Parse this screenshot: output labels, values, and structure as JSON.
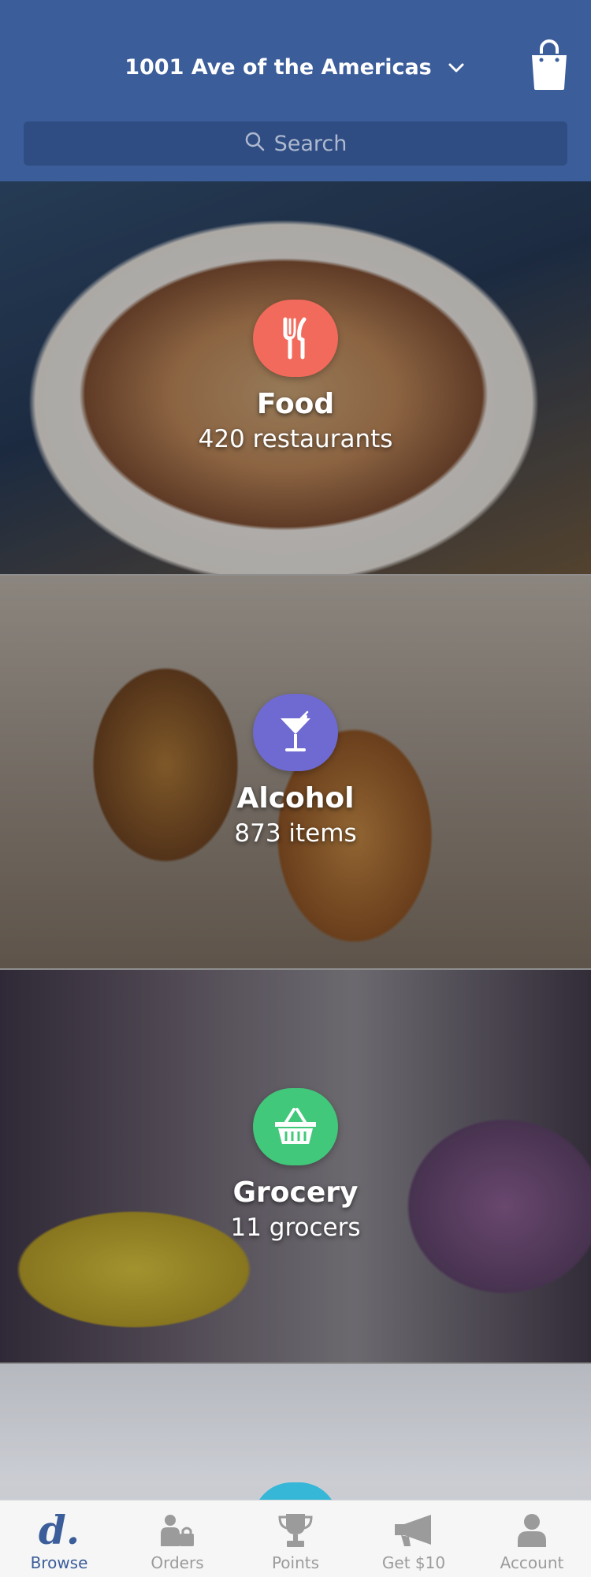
{
  "header": {
    "address": "1001 Ave of the Americas",
    "cart_icon": "shopping-bag-icon",
    "address_dropdown_icon": "chevron-down-icon"
  },
  "search": {
    "placeholder": "Search",
    "icon": "search-icon"
  },
  "categories": [
    {
      "title": "Food",
      "subtitle": "420 restaurants",
      "icon": "fork-knife-icon",
      "color": "#f26a5b"
    },
    {
      "title": "Alcohol",
      "subtitle": "873 items",
      "icon": "cocktail-icon",
      "color": "#6f6ad1"
    },
    {
      "title": "Grocery",
      "subtitle": "11 grocers",
      "icon": "basket-icon",
      "color": "#41c87a"
    },
    {
      "icon": "category-icon",
      "color": "#36b7d8"
    }
  ],
  "tabs": [
    {
      "label": "Browse",
      "icon": "browse-logo-icon",
      "active": true
    },
    {
      "label": "Orders",
      "icon": "orders-icon",
      "active": false
    },
    {
      "label": "Points",
      "icon": "trophy-icon",
      "active": false
    },
    {
      "label": "Get $10",
      "icon": "megaphone-icon",
      "active": false
    },
    {
      "label": "Account",
      "icon": "account-icon",
      "active": false
    }
  ],
  "colors": {
    "header_bg": "#3b5d9a",
    "search_bg": "#2f4d82",
    "active_tab": "#3b5d9a",
    "inactive_tab": "#9b9b9b"
  }
}
